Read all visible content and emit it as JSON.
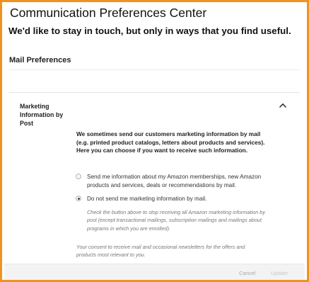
{
  "header": {
    "title": "Communication Preferences Center",
    "subtitle": "We'd like to stay in touch, but only in ways that you find useful."
  },
  "section": {
    "heading": "Mail Preferences"
  },
  "card": {
    "label": "Marketing Information by Post",
    "chevron_icon": "chevron-up-icon",
    "intro": "We sometimes send our customers marketing information by mail (e.g. printed product catalogs, letters about products and services). Here you can choose if you want to receive such information.",
    "options": [
      {
        "label": "Send me information about my Amazon memberships, new Amazon products and services, deals or recommendations by mail.",
        "selected": false
      },
      {
        "label": "Do not send me marketing information by mail.",
        "selected": true
      }
    ],
    "helper_text": "Check the button above to stop receiving all Amazon marketing information by post (except transactional mailings, subscription mailings and mailings about programs in which you are enrolled).",
    "consent_text": "Your consent to receive mail and occasional newsletters for the offers and products most relevant to you."
  },
  "actions": {
    "cancel_label": "Cancel",
    "update_label": "Update"
  },
  "colors": {
    "frame_border": "#f0931e",
    "action_bar_bg": "#f3f3f3"
  }
}
